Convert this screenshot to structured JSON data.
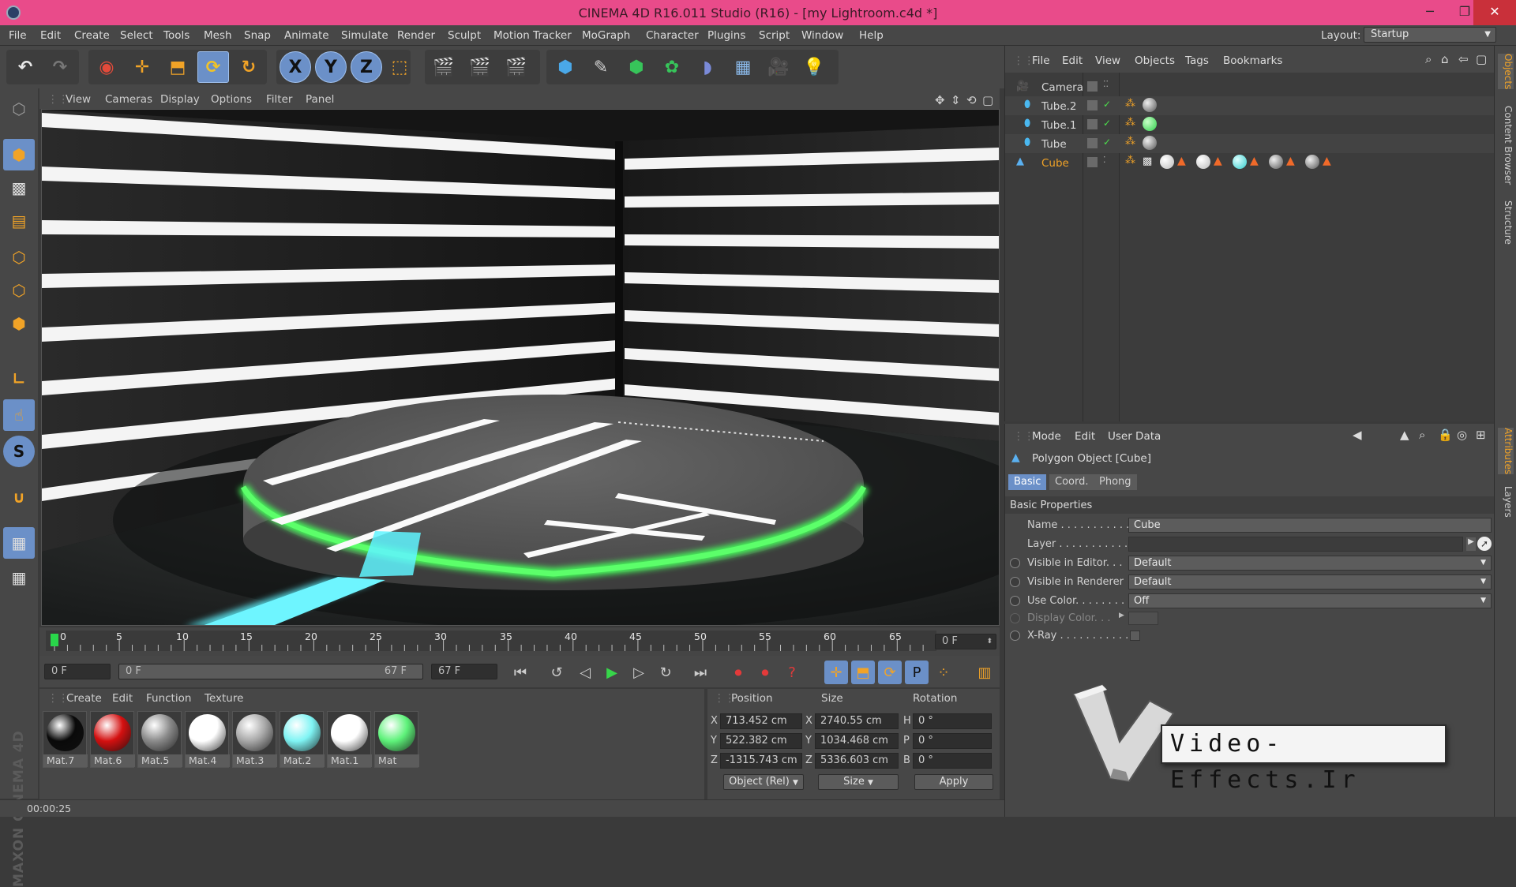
{
  "window": {
    "title": "CINEMA 4D R16.011 Studio (R16) - [my Lightroom.c4d *]",
    "min": "─",
    "max": "❐",
    "close": "✕"
  },
  "menu": [
    "File",
    "Edit",
    "Create",
    "Select",
    "Tools",
    "Mesh",
    "Snap",
    "Animate",
    "Simulate",
    "Render",
    "Sculpt",
    "Motion Tracker",
    "MoGraph",
    "Character",
    "Plugins",
    "Script",
    "Window",
    "Help"
  ],
  "layout": {
    "label": "Layout:",
    "value": "Startup"
  },
  "toolbar": {
    "undo": "↶",
    "redo": "↷",
    "x": "X",
    "y": "Y",
    "z": "Z"
  },
  "viewport": {
    "menu": [
      "View",
      "Cameras",
      "Display",
      "Options",
      "Filter",
      "Panel"
    ]
  },
  "timeline": {
    "ticks": [
      "0",
      "5",
      "10",
      "15",
      "20",
      "25",
      "30",
      "35",
      "40",
      "45",
      "50",
      "55",
      "60",
      "65"
    ],
    "current_frame": "0 F"
  },
  "transport": {
    "start": "0 F",
    "range_start": "0 F",
    "range_end": "67 F",
    "end": "67 F"
  },
  "materials": {
    "menu": [
      "Create",
      "Edit",
      "Function",
      "Texture"
    ],
    "items": [
      {
        "name": "Mat.7",
        "color": "#0a0a0a"
      },
      {
        "name": "Mat.6",
        "color": "#d41010"
      },
      {
        "name": "Mat.5",
        "color": "#8a8a8a"
      },
      {
        "name": "Mat.4",
        "color": "#ffffff"
      },
      {
        "name": "Mat.3",
        "color": "#a8a8a8"
      },
      {
        "name": "Mat.2",
        "color": "#7ff4f4"
      },
      {
        "name": "Mat.1",
        "color": "#ffffff"
      },
      {
        "name": "Mat",
        "color": "#5ef27a"
      }
    ]
  },
  "coords": {
    "headers": [
      "Position",
      "Size",
      "Rotation"
    ],
    "axes": [
      "X",
      "Y",
      "Z"
    ],
    "rot_axes": [
      "H",
      "P",
      "B"
    ],
    "position": [
      "713.452 cm",
      "522.382 cm",
      "-1315.743 cm"
    ],
    "size": [
      "2740.55 cm",
      "1034.468 cm",
      "5336.603 cm"
    ],
    "rotation": [
      "0 °",
      "0 °",
      "0 °"
    ],
    "mode": "Object (Rel)",
    "size_mode": "Size",
    "apply": "Apply"
  },
  "status": {
    "time": "00:00:25"
  },
  "objects": {
    "menu": [
      "File",
      "Edit",
      "View",
      "Objects",
      "Tags",
      "Bookmarks"
    ],
    "items": [
      "Camera",
      "Tube.2",
      "Tube.1",
      "Tube",
      "Cube"
    ]
  },
  "attributes": {
    "menu": [
      "Mode",
      "Edit",
      "User Data"
    ],
    "title": "Polygon Object [Cube]",
    "tabs": [
      "Basic",
      "Coord.",
      "Phong"
    ],
    "section": "Basic Properties",
    "fields": {
      "name_label": "Name . . . . . . . . . . .",
      "name_value": "Cube",
      "layer_label": "Layer . . . . . . . . . . .",
      "vis_editor_label": "Visible in Editor. . .",
      "vis_editor_value": "Default",
      "vis_renderer_label": "Visible in Renderer",
      "vis_renderer_value": "Default",
      "use_color_label": "Use Color. . . . . . . .",
      "use_color_value": "Off",
      "display_color_label": "Display Color. . .",
      "xray_label": "X-Ray . . . . . . . . . . ."
    }
  },
  "right_tabs": [
    "Objects",
    "Content Browser",
    "Structure",
    "Attributes",
    "Layers"
  ],
  "branding": {
    "maxon": "MAXON CINEMA 4D",
    "watermark": "Video-Effects.Ir"
  }
}
